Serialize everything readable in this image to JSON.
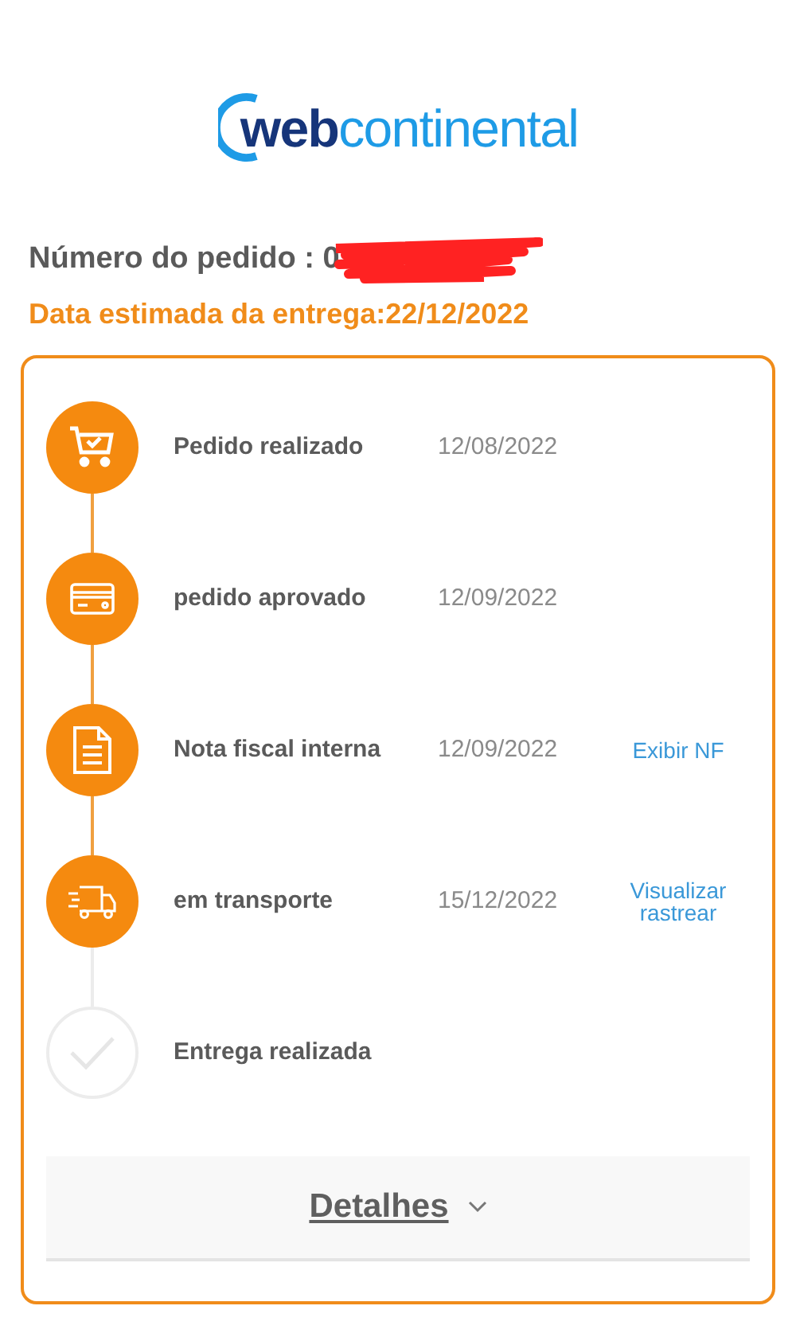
{
  "logo": {
    "part_1": "web",
    "part_2": "continental"
  },
  "order_number": "Número do pedido : 0",
  "estimated_delivery": "Data estimada da entrega:22/12/2022",
  "steps": [
    {
      "kind": "cart",
      "label": "Pedido realizado",
      "date": "12/08/2022",
      "done": true
    },
    {
      "kind": "card",
      "label": "pedido aprovado",
      "date": "12/09/2022",
      "done": true
    },
    {
      "kind": "document",
      "label": "Nota fiscal interna",
      "date": "12/09/2022",
      "done": true,
      "action": "Exibir NF"
    },
    {
      "kind": "truck",
      "label": "em transporte",
      "date": "15/12/2022",
      "done": true,
      "action": "Visualizar rastrear"
    },
    {
      "kind": "check",
      "label": "Entrega realizada",
      "done": false
    }
  ],
  "details_button": "Detalhes"
}
